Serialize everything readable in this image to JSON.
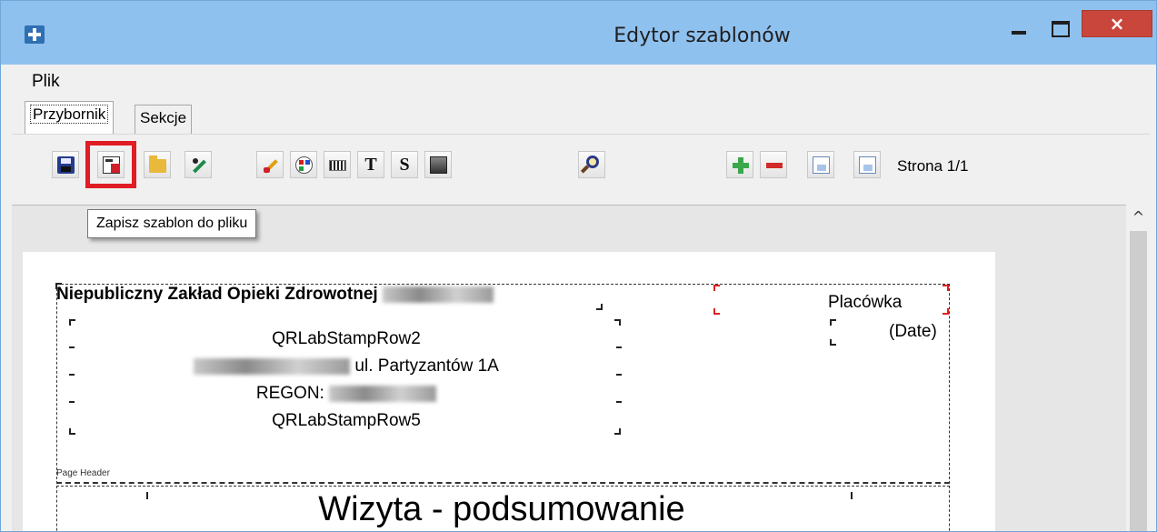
{
  "window": {
    "title": "Edytor szablonów",
    "close_glyph": "×",
    "accent_color": "#8fc1ef",
    "close_color": "#c9463d"
  },
  "menu": {
    "items": [
      "Plik"
    ]
  },
  "tabs": [
    {
      "label": "Przybornik",
      "active": true
    },
    {
      "label": "Sekcje",
      "active": false
    }
  ],
  "toolbar": {
    "buttons": [
      {
        "icon": "save-disk-icon"
      },
      {
        "icon": "save-template-to-file-icon",
        "highlighted": true
      },
      {
        "icon": "open-folder-icon"
      },
      {
        "icon": "edit-pen-icon"
      },
      {
        "icon": "magic-wand-icon"
      },
      {
        "icon": "color-palette-icon"
      },
      {
        "icon": "barcode-icon"
      },
      {
        "icon": "text-label-icon",
        "glyph": "T"
      },
      {
        "icon": "system-field-icon",
        "glyph": "S"
      },
      {
        "icon": "image-icon"
      },
      {
        "icon": "zoom-icon"
      },
      {
        "icon": "add-page-icon"
      },
      {
        "icon": "remove-page-icon"
      },
      {
        "icon": "previous-page-icon"
      },
      {
        "icon": "next-page-icon"
      }
    ],
    "page_indicator": "Strona 1/1",
    "highlight_color": "#e01c24"
  },
  "tooltip": {
    "text": "Zapisz szablon do pliku"
  },
  "report": {
    "org_name": "Niepubliczny Zakład Opieki Zdrowotnej",
    "stamp_rows": {
      "row1": "QRLabStampRow2",
      "row2_street": "ul. Partyzantów 1A",
      "row3_prefix": "REGON:",
      "row4": "QRLabStampRow5"
    },
    "placowka_label": "Placówka",
    "date_label": "(Date)",
    "band_label": "Page Header",
    "title": "Wizyta - podsumowanie"
  },
  "scrollbar": {
    "up_glyph": "^"
  }
}
